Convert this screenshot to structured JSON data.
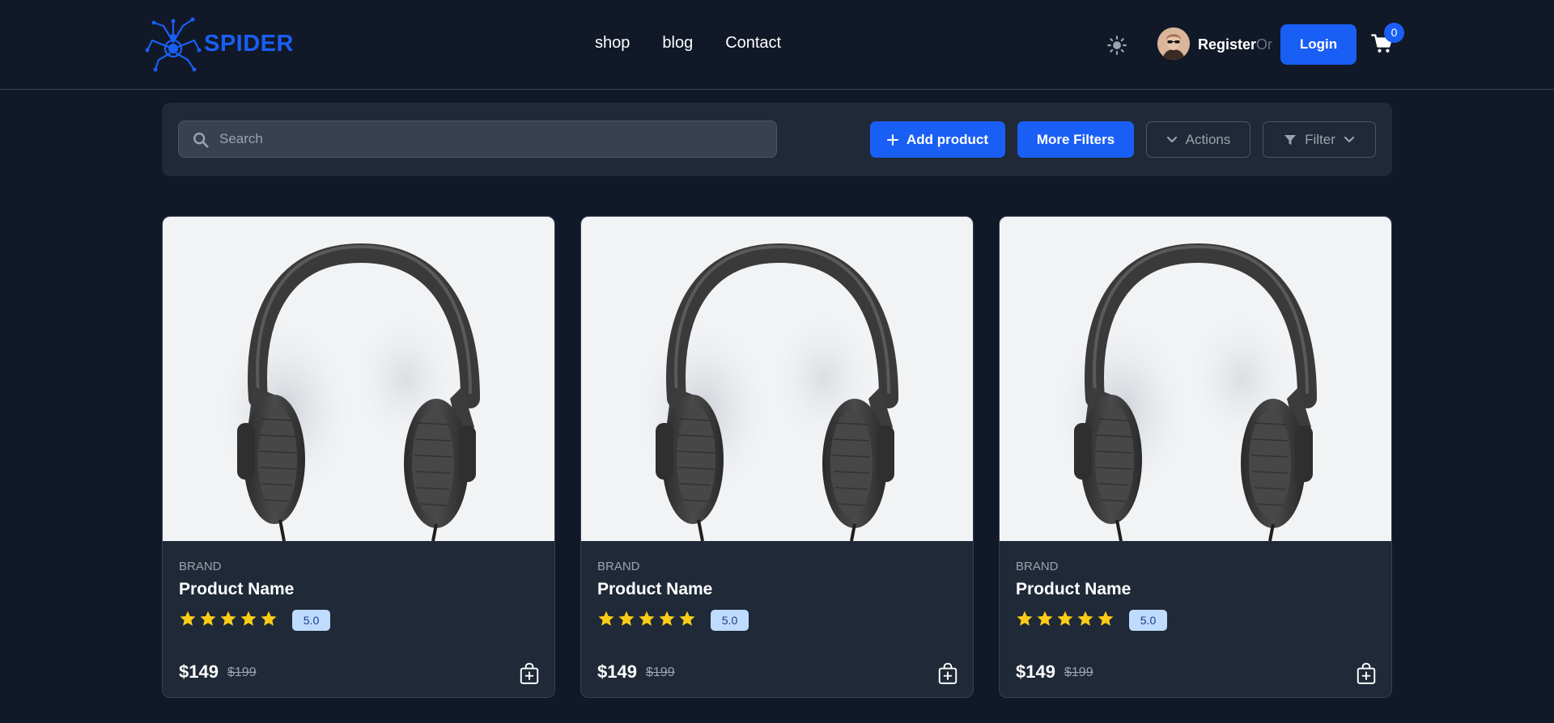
{
  "header": {
    "logo_text": "SPIDER",
    "nav": [
      "shop",
      "blog",
      "Contact"
    ],
    "register_label": "Register",
    "or_label": "Or",
    "login_label": "Login",
    "cart_count": "0"
  },
  "toolbar": {
    "search_placeholder": "Search",
    "add_product_label": "Add product",
    "more_filters_label": "More Filters",
    "actions_label": "Actions",
    "filter_label": "Filter"
  },
  "products": [
    {
      "brand": "BRAND",
      "name": "Product Name",
      "rating": "5.0",
      "stars": 5,
      "price": "$149",
      "old_price": "$199"
    },
    {
      "brand": "BRAND",
      "name": "Product Name",
      "rating": "5.0",
      "stars": 5,
      "price": "$149",
      "old_price": "$199"
    },
    {
      "brand": "BRAND",
      "name": "Product Name",
      "rating": "5.0",
      "stars": 5,
      "price": "$149",
      "old_price": "$199"
    }
  ],
  "colors": {
    "background": "#111827",
    "surface": "#1f2937",
    "accent": "#1a5ff5",
    "star": "#facc15",
    "rating_badge": "#bfdbfe"
  }
}
